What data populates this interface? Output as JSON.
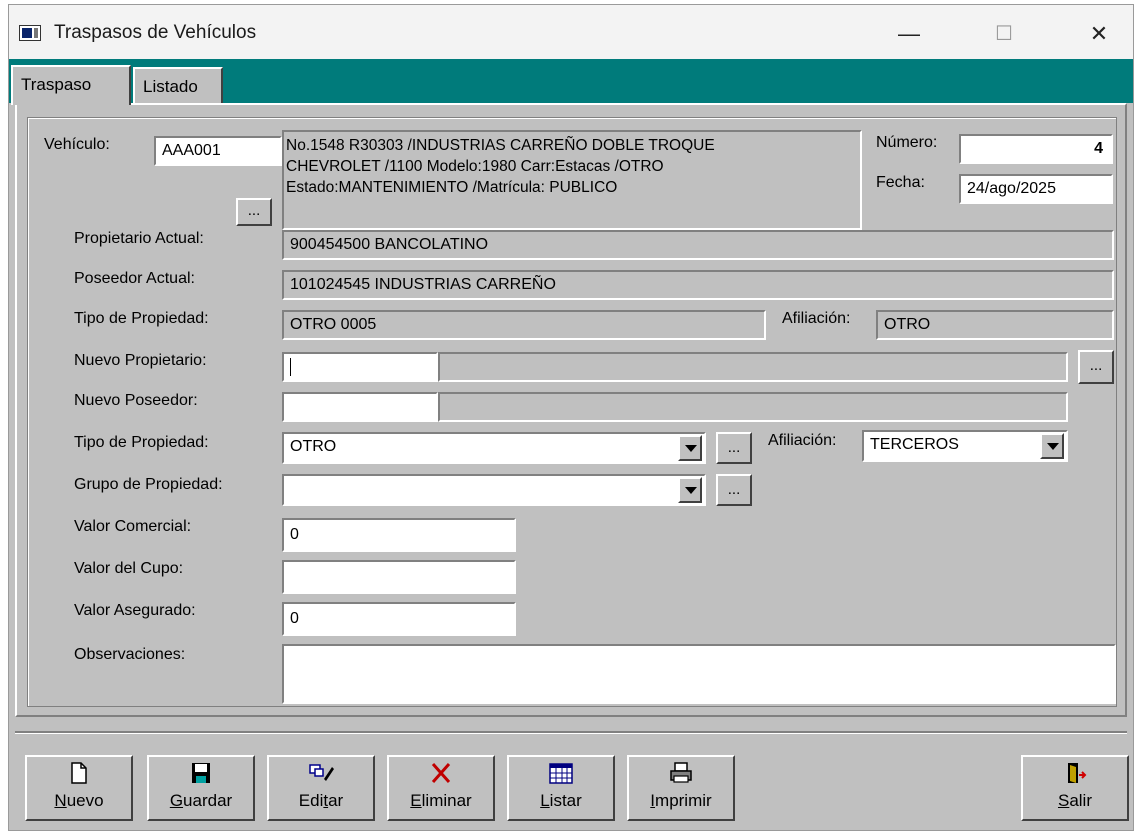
{
  "window": {
    "title": "Traspasos de Vehículos",
    "minimize": "—",
    "maximize": "☐",
    "close": "✕"
  },
  "tabs": [
    {
      "label": "Traspaso"
    },
    {
      "label": "Listado"
    }
  ],
  "form": {
    "vehiculo_label": "Vehículo:",
    "vehiculo_value": "AAA001",
    "vehiculo_lookup": "...",
    "vehiculo_desc": [
      "No.1548  R30303 /INDUSTRIAS CARREÑO DOBLE TROQUE",
      "CHEVROLET /1100 Modelo:1980 Carr:Estacas /OTRO",
      "Estado:MANTENIMIENTO /Matrícula: PUBLICO"
    ],
    "numero_label": "Número:",
    "numero_value": "4",
    "fecha_label": "Fecha:",
    "fecha_value": "24/ago/2025",
    "propietario_actual_label": "Propietario Actual:",
    "propietario_actual_value": "900454500 BANCOLATINO",
    "poseedor_actual_label": "Poseedor Actual:",
    "poseedor_actual_value": "101024545 INDUSTRIAS CARREÑO",
    "tipo_propiedad_actual_label": "Tipo de Propiedad:",
    "tipo_propiedad_actual_value": "OTRO 0005",
    "afiliacion_actual_label": "Afiliación:",
    "afiliacion_actual_value": "OTRO",
    "nuevo_propietario_label": "Nuevo Propietario:",
    "nuevo_propietario_value": "",
    "nuevo_propietario_desc": "",
    "nuevo_propietario_lookup": "...",
    "nuevo_poseedor_label": "Nuevo Poseedor:",
    "nuevo_poseedor_value": "",
    "nuevo_poseedor_desc": "",
    "tipo_propiedad_label": "Tipo de Propiedad:",
    "tipo_propiedad_value": "OTRO",
    "tipo_propiedad_lookup": "...",
    "afiliacion_label": "Afiliación:",
    "afiliacion_value": "TERCEROS",
    "grupo_propiedad_label": "Grupo de Propiedad:",
    "grupo_propiedad_value": "",
    "grupo_propiedad_lookup": "...",
    "valor_comercial_label": "Valor Comercial:",
    "valor_comercial_value": "0",
    "valor_cupo_label": "Valor del Cupo:",
    "valor_cupo_value": "",
    "valor_asegurado_label": "Valor Asegurado:",
    "valor_asegurado_value": "0",
    "observaciones_label": "Observaciones:",
    "observaciones_value": ""
  },
  "toolbar": {
    "nuevo": {
      "u": "N",
      "rest": "uevo"
    },
    "guardar": {
      "u": "G",
      "rest": "uardar"
    },
    "editar": {
      "pre": "Edi",
      "u": "t",
      "rest": "ar"
    },
    "eliminar": {
      "u": "E",
      "rest": "liminar"
    },
    "listar": {
      "u": "L",
      "rest": "istar"
    },
    "imprimir": {
      "u": "I",
      "rest": "mprimir"
    },
    "salir": {
      "u": "S",
      "rest": "alir"
    }
  }
}
